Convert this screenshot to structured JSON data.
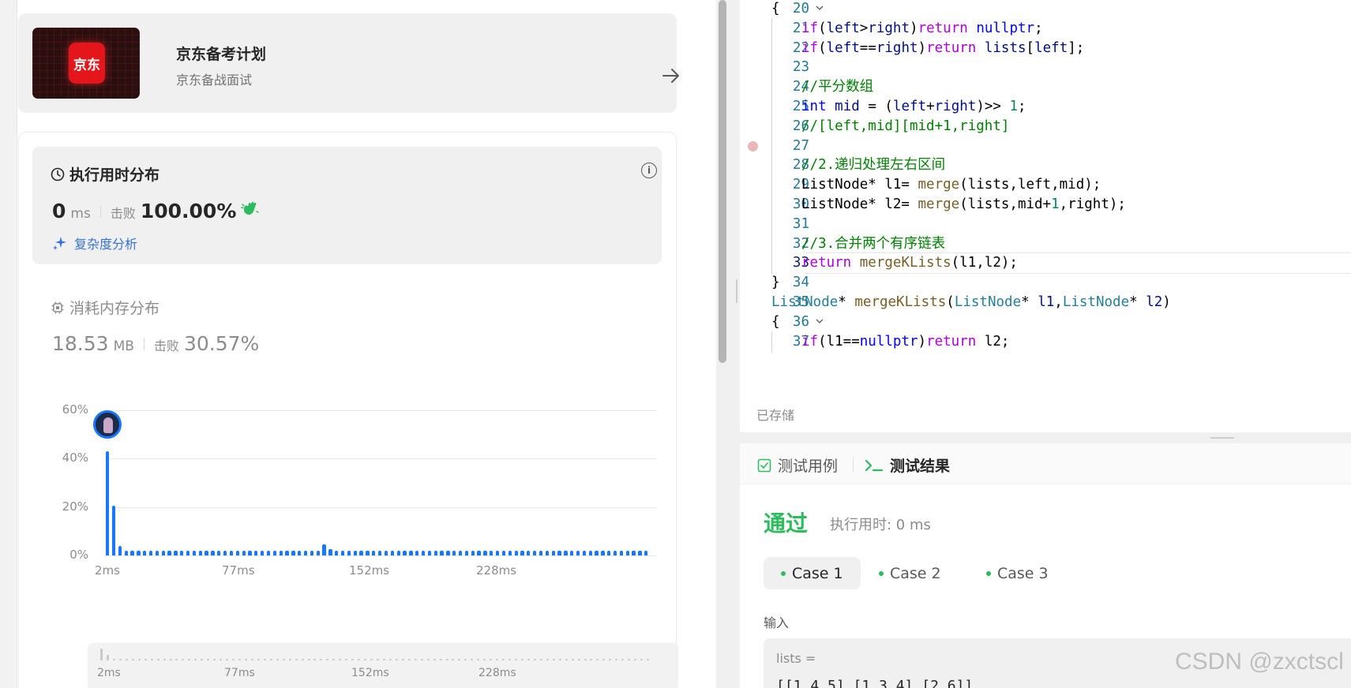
{
  "banner": {
    "logo_text": "京东",
    "title": "京东备考计划",
    "subtitle": "京东备战面试"
  },
  "runtime": {
    "title": "执行用时分布",
    "value": "0",
    "unit": "ms",
    "beat_label": "击败",
    "beat_value": "100.00%",
    "complexity_link": "复杂度分析"
  },
  "memory": {
    "title": "消耗内存分布",
    "value": "18.53",
    "unit": "MB",
    "beat_label": "击败",
    "beat_value": "30.57%"
  },
  "chart_data": {
    "type": "bar",
    "title": "",
    "xlabel": "",
    "ylabel": "",
    "ylim": [
      0,
      60
    ],
    "y_ticks": [
      "60%",
      "40%",
      "20%",
      "0%"
    ],
    "x_ticks": [
      "2ms",
      "77ms",
      "152ms",
      "228ms"
    ],
    "values": [
      43,
      20.5,
      4,
      2,
      2,
      2,
      2,
      2,
      2,
      2,
      2,
      2,
      2,
      2,
      2,
      2,
      2,
      2,
      2,
      2,
      2,
      2,
      2,
      2,
      2,
      2,
      2,
      2,
      2,
      2,
      2,
      2,
      2,
      2,
      2,
      4.5,
      2.5,
      2,
      2,
      2,
      2,
      2,
      2,
      2,
      2,
      2,
      2,
      2,
      2,
      2,
      2,
      2,
      2,
      2,
      2,
      2,
      2,
      2,
      2,
      2,
      2,
      2,
      2,
      2,
      2,
      2,
      2,
      2,
      2,
      2,
      2,
      2,
      2,
      2,
      2,
      2,
      2,
      2,
      2,
      2,
      2,
      2,
      2,
      2,
      2,
      2,
      2,
      2
    ],
    "grid": true
  },
  "minimap_ticks": [
    "2ms",
    "77ms",
    "152ms",
    "228ms"
  ],
  "editor": {
    "lines": [
      {
        "n": "20",
        "fold": true,
        "indent": 1,
        "html": "<span class='p'>{</span>"
      },
      {
        "n": "21",
        "indent": 2,
        "html": "<span class='k'>if</span><span class='p'>(</span><span class='v'>left</span><span class='p'>&gt;</span><span class='v'>right</span><span class='p'>)</span><span class='k'>return</span> <span class='t'>nullptr</span><span class='p'>;</span>"
      },
      {
        "n": "22",
        "indent": 2,
        "html": "<span class='k'>if</span><span class='p'>(</span><span class='v'>left</span><span class='p'>==</span><span class='v'>right</span><span class='p'>)</span><span class='k'>return</span> <span class='v'>lists</span><span class='p'>[</span><span class='v'>left</span><span class='p'>];</span>"
      },
      {
        "n": "23",
        "indent": 2,
        "html": ""
      },
      {
        "n": "24",
        "indent": 2,
        "html": "<span class='c'>//平分数组</span>"
      },
      {
        "n": "25",
        "indent": 2,
        "html": "<span class='t'>int</span> <span class='v'>mid</span> <span class='p'>= (</span><span class='v'>left</span><span class='p'>+</span><span class='v'>right</span><span class='p'>)&gt;&gt; </span><span class='n'>1</span><span class='p'>;</span>"
      },
      {
        "n": "26",
        "indent": 2,
        "html": "<span class='c'>//[left,mid][mid+1,right]</span>"
      },
      {
        "n": "27",
        "indent": 2,
        "bp": true,
        "html": ""
      },
      {
        "n": "28",
        "indent": 2,
        "html": "<span class='c'>//2.递归处理左右区间</span>"
      },
      {
        "n": "29",
        "indent": 2,
        "html": "<span class='p'>ListNode* l1= </span><span class='f'>merge</span><span class='p'>(lists,left,mid);</span>"
      },
      {
        "n": "30",
        "indent": 2,
        "html": "<span class='p'>ListNode* l2= </span><span class='f'>merge</span><span class='p'>(lists,mid+</span><span class='n'>1</span><span class='p'>,right);</span>"
      },
      {
        "n": "31",
        "indent": 2,
        "html": ""
      },
      {
        "n": "32",
        "indent": 2,
        "html": "<span class='c'>//3.合并两个有序链表</span>"
      },
      {
        "n": "33",
        "indent": 2,
        "current": true,
        "html": "<span class='k'>return</span> <span class='f'>mergeKLists</span><span class='p'>(l1,l2);</span>"
      },
      {
        "n": "34",
        "indent": 1,
        "html": "<span class='p'>}</span>"
      },
      {
        "n": "35",
        "indent": 0,
        "html": "<span class='ty'>ListNode</span><span class='p'>* </span><span class='f'>mergeKLists</span><span class='p'>(</span><span class='ty'>ListNode</span><span class='p'>* </span><span class='v'>l1</span><span class='p'>,</span><span class='ty'>ListNode</span><span class='p'>* </span><span class='v'>l2</span><span class='p'>)</span>"
      },
      {
        "n": "36",
        "fold": true,
        "indent": 1,
        "html": "<span class='p'>{</span>"
      },
      {
        "n": "37",
        "indent": 2,
        "html": "<span class='k'>if</span><span class='p'>(l1==</span><span class='t'>nullptr</span><span class='p'>)</span><span class='k'>return</span><span class='p'> l2;</span>"
      }
    ],
    "saved_label": "已存储"
  },
  "result": {
    "tab_testcase": "测试用例",
    "tab_result": "测试结果",
    "status": "通过",
    "exec_time": "执行用时: 0 ms",
    "cases": [
      "Case 1",
      "Case 2",
      "Case 3"
    ],
    "input_label": "输入",
    "input_name": "lists =",
    "input_value": "[[1,4,5],[1,3,4],[2,6]]"
  },
  "watermark": "CSDN @zxctscl",
  "colors": {
    "accent_blue": "#1677ff",
    "passed_green": "#2cbb5d",
    "jd_red": "#e4161b"
  }
}
